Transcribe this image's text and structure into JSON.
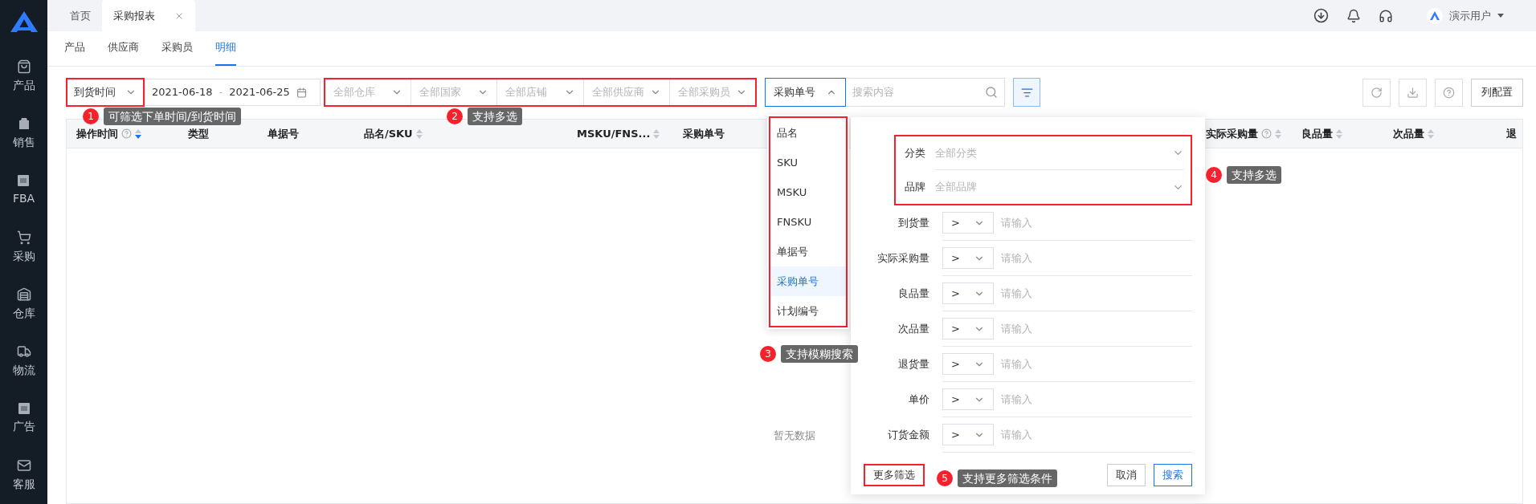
{
  "sidebar": {
    "items": [
      {
        "label": "产品"
      },
      {
        "label": "销售"
      },
      {
        "label": "FBA"
      },
      {
        "label": "采购"
      },
      {
        "label": "仓库"
      },
      {
        "label": "物流"
      },
      {
        "label": "广告"
      },
      {
        "label": "客服"
      }
    ]
  },
  "top_tabs": [
    {
      "label": "首页",
      "selected": false,
      "closable": false
    },
    {
      "label": "采购报表",
      "selected": true,
      "closable": true
    }
  ],
  "user": {
    "name": "演示用户"
  },
  "sub_tabs": [
    {
      "label": "产品",
      "selected": false
    },
    {
      "label": "供应商",
      "selected": false
    },
    {
      "label": "采购员",
      "selected": false
    },
    {
      "label": "明细",
      "selected": true
    }
  ],
  "filters": {
    "date_type": {
      "value": "到货时间",
      "highlighted": true
    },
    "date_range": {
      "start": "2021-06-18",
      "separator": "-",
      "end": "2021-06-25"
    },
    "selects_highlighted": true,
    "selects": [
      {
        "placeholder": "全部仓库"
      },
      {
        "placeholder": "全部国家"
      },
      {
        "placeholder": "全部店铺"
      },
      {
        "placeholder": "全部供应商"
      },
      {
        "placeholder": "全部采购员"
      }
    ],
    "search_type": {
      "value": "采购单号",
      "expanded": true
    },
    "search": {
      "placeholder": "搜索内容"
    }
  },
  "toolbar": {
    "column_settings": "列配置"
  },
  "table": {
    "columns": [
      {
        "label": "操作时间",
        "help": true,
        "sortable": true,
        "sorted": true
      },
      {
        "label": "类型",
        "help": false,
        "sortable": false
      },
      {
        "label": "单据号",
        "help": false,
        "sortable": false
      },
      {
        "label": "品名/SKU",
        "help": false,
        "sortable": true,
        "sorted": false
      },
      {
        "label": "MSKU/FNS...",
        "help": false,
        "sortable": true,
        "sorted": false
      },
      {
        "label": "采购单号",
        "help": false,
        "sortable": false
      },
      {
        "label": "实际采购量",
        "help": true,
        "sortable": true,
        "sorted": false
      },
      {
        "label": "良品量",
        "help": false,
        "sortable": true,
        "sorted": false
      },
      {
        "label": "次品量",
        "help": false,
        "sortable": true,
        "sorted": false
      },
      {
        "label": "退",
        "help": false,
        "sortable": false
      }
    ],
    "empty_text": "暂无数据"
  },
  "search_type_menu": {
    "highlighted": true,
    "items": [
      {
        "label": "品名",
        "selected": false
      },
      {
        "label": "SKU",
        "selected": false
      },
      {
        "label": "MSKU",
        "selected": false
      },
      {
        "label": "FNSKU",
        "selected": false
      },
      {
        "label": "单据号",
        "selected": false
      },
      {
        "label": "采购单号",
        "selected": true
      },
      {
        "label": "计划编号",
        "selected": false
      }
    ]
  },
  "filter_panel": {
    "group_highlighted": true,
    "selects": [
      {
        "label": "分类",
        "placeholder": "全部分类"
      },
      {
        "label": "品牌",
        "placeholder": "全部品牌"
      }
    ],
    "ranges": [
      {
        "label": "到货量",
        "operator": ">",
        "placeholder": "请输入"
      },
      {
        "label": "实际采购量",
        "operator": ">",
        "placeholder": "请输入"
      },
      {
        "label": "良品量",
        "operator": ">",
        "placeholder": "请输入"
      },
      {
        "label": "次品量",
        "operator": ">",
        "placeholder": "请输入"
      },
      {
        "label": "退货量",
        "operator": ">",
        "placeholder": "请输入"
      },
      {
        "label": "单价",
        "operator": ">",
        "placeholder": "请输入"
      },
      {
        "label": "订货金额",
        "operator": ">",
        "placeholder": "请输入"
      }
    ],
    "more_button": {
      "label": "更多筛选",
      "highlighted": true
    },
    "cancel": "取消",
    "search": "搜索"
  },
  "annotations": [
    {
      "number": "1",
      "text": "可筛选下单时间/到货时间"
    },
    {
      "number": "2",
      "text": "支持多选"
    },
    {
      "number": "3",
      "text": "支持模糊搜索"
    },
    {
      "number": "4",
      "text": "支持多选"
    },
    {
      "number": "5",
      "text": "支持更多筛选条件"
    }
  ]
}
